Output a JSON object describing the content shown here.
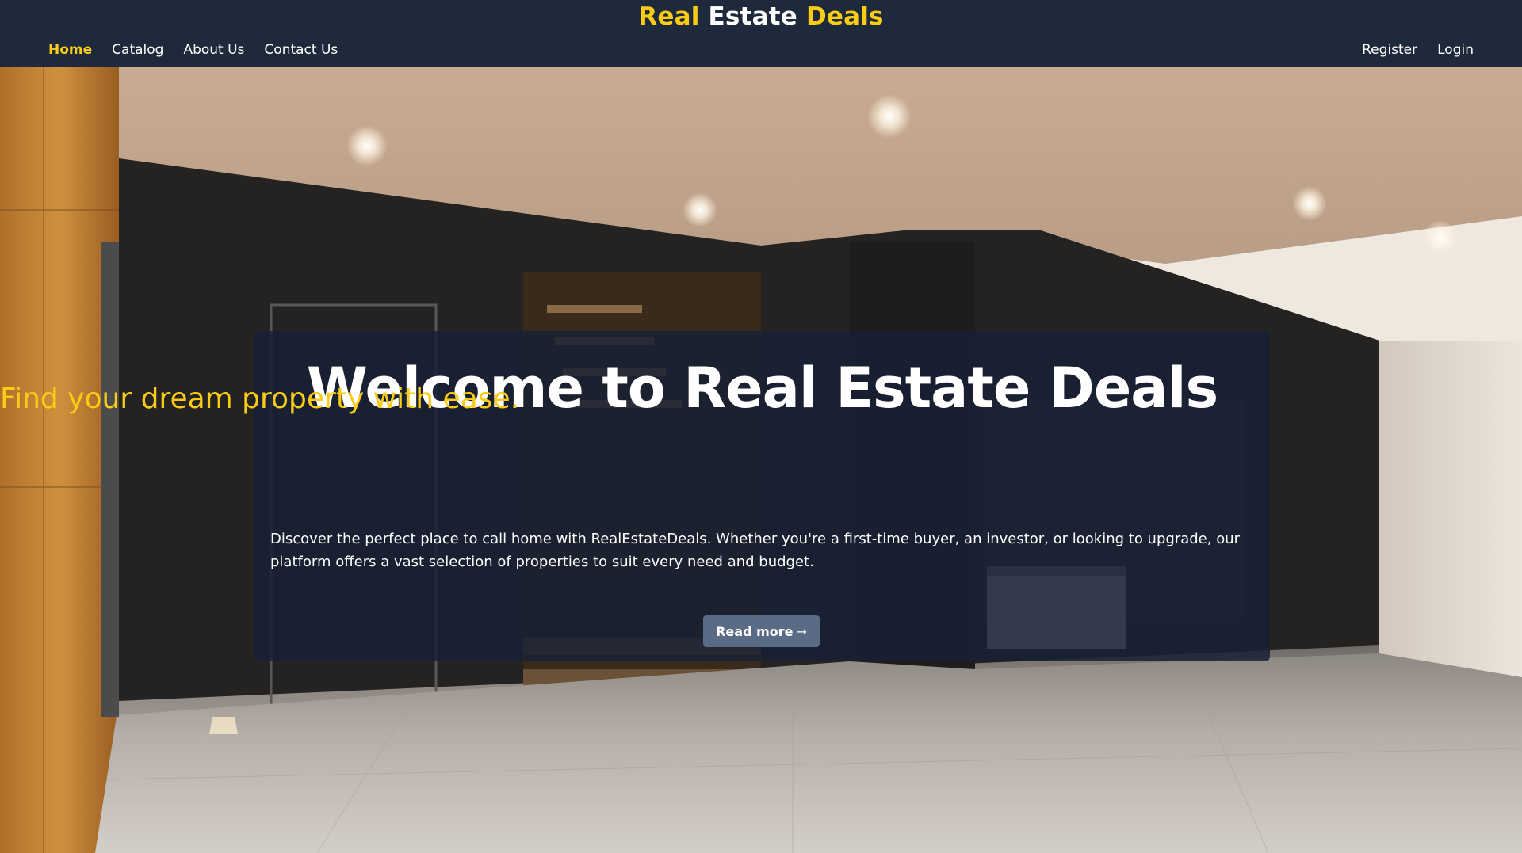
{
  "header": {
    "brand": {
      "part1": "Real",
      "part2": "Estate",
      "part3": "Deals"
    },
    "nav_left": [
      "Home",
      "Catalog",
      "About Us",
      "Contact Us"
    ],
    "nav_right": [
      "Register",
      "Login"
    ],
    "active_item": "Home"
  },
  "hero": {
    "title": "Welcome to Real Estate Deals",
    "subtitle": "Find your dream property with ease.",
    "description": "Discover the perfect place to call home with RealEstateDeals. Whether you're a first-time buyer, an investor, or looking to upgrade, our platform offers a vast selection of properties to suit every need and budget.",
    "button_label": "Read more",
    "button_icon": "arrow-right-icon"
  },
  "colors": {
    "header_bg": "#1e293b",
    "accent": "#facc15",
    "panel_bg": "#172034",
    "button_bg": "#5a6b86"
  }
}
